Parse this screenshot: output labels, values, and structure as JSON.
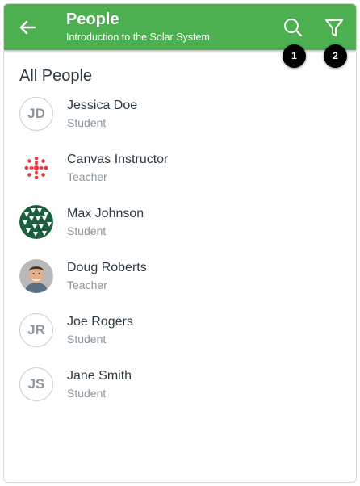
{
  "header": {
    "title": "People",
    "subtitle": "Introduction to the Solar System",
    "color": "#4caf50"
  },
  "callouts": [
    "1",
    "2"
  ],
  "section_title": "All People",
  "people": [
    {
      "name": "Jessica Doe",
      "role": "Student",
      "initials": "JD",
      "avatar": "initials"
    },
    {
      "name": "Canvas Instructor",
      "role": "Teacher",
      "avatar": "canvas-logo"
    },
    {
      "name": "Max Johnson",
      "role": "Student",
      "avatar": "pattern"
    },
    {
      "name": "Doug Roberts",
      "role": "Teacher",
      "avatar": "photo"
    },
    {
      "name": "Joe Rogers",
      "role": "Student",
      "initials": "JR",
      "avatar": "initials"
    },
    {
      "name": "Jane Smith",
      "role": "Student",
      "initials": "JS",
      "avatar": "initials"
    }
  ]
}
